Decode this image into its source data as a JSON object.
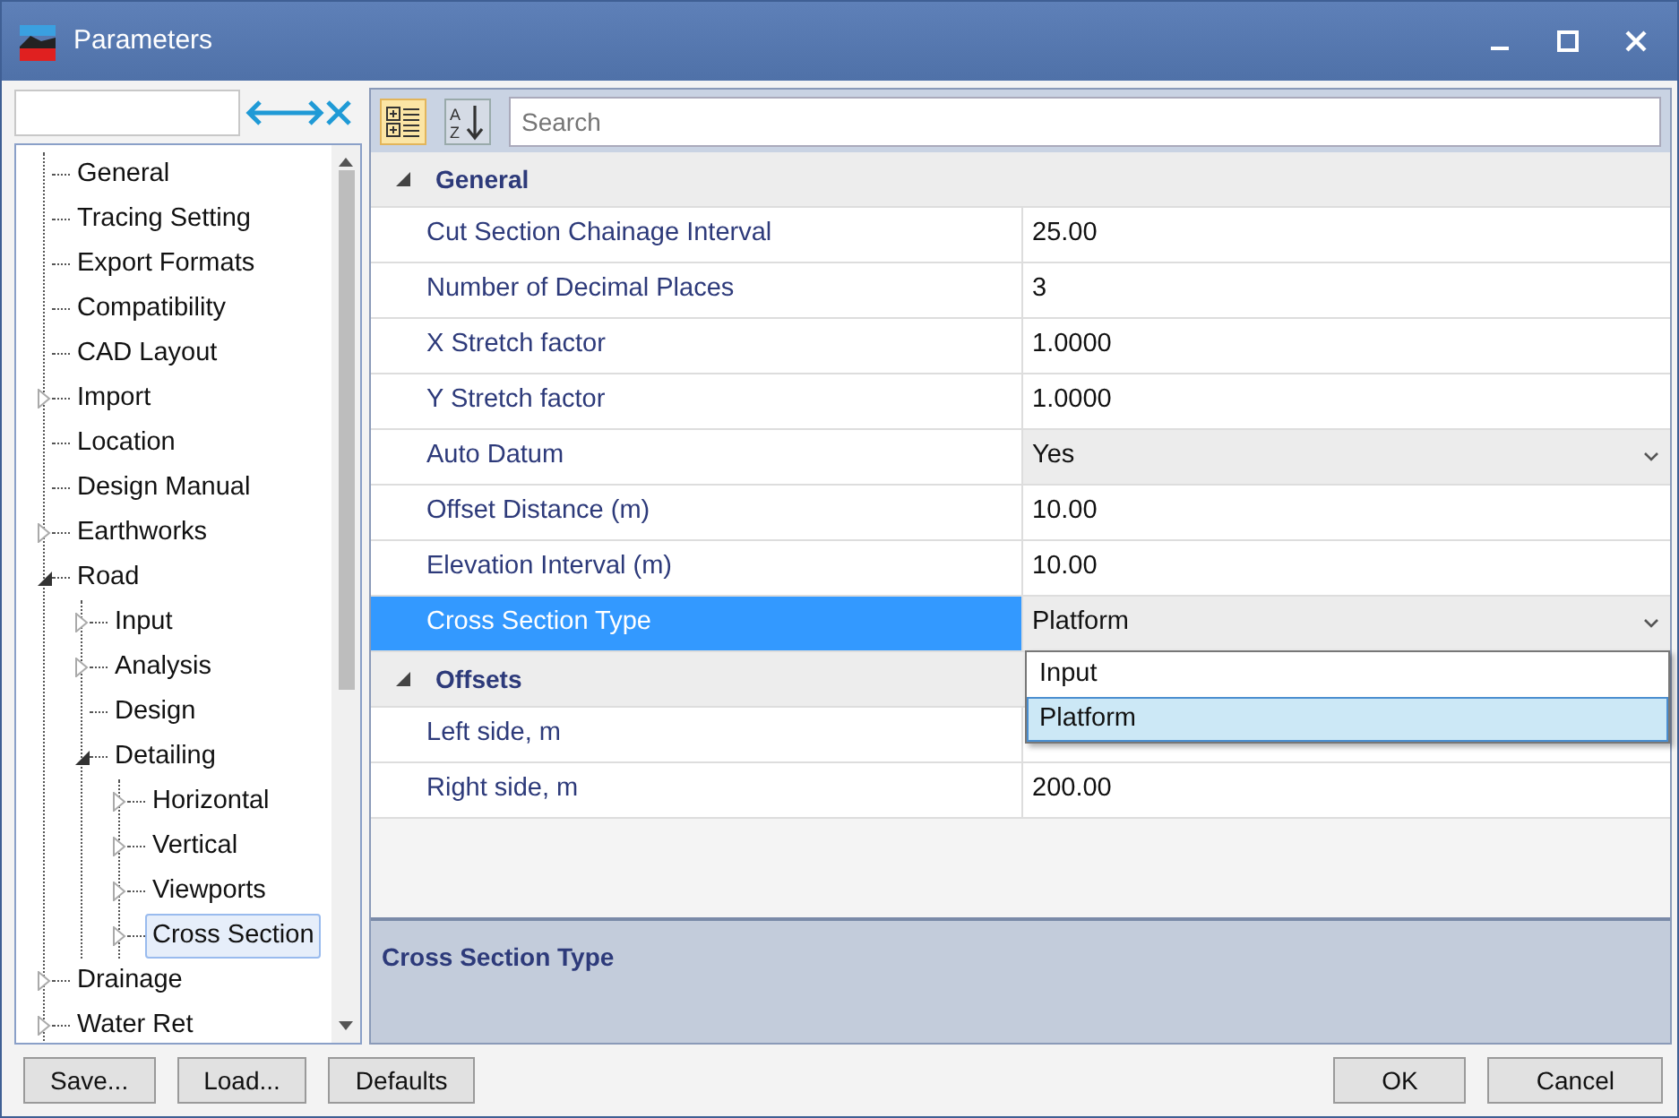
{
  "window": {
    "title": "Parameters"
  },
  "tree": {
    "nodes": [
      {
        "label": "General",
        "expandable": false,
        "selected": false
      },
      {
        "label": "Tracing Setting",
        "expandable": false,
        "selected": false
      },
      {
        "label": "Export Formats",
        "expandable": false,
        "selected": false
      },
      {
        "label": "Compatibility",
        "expandable": false,
        "selected": false
      },
      {
        "label": "CAD Layout",
        "expandable": false,
        "selected": false
      },
      {
        "label": "Import",
        "expandable": true,
        "expanded": false,
        "selected": false
      },
      {
        "label": "Location",
        "expandable": false,
        "selected": false
      },
      {
        "label": "Design Manual",
        "expandable": false,
        "selected": false
      },
      {
        "label": "Earthworks",
        "expandable": true,
        "expanded": false,
        "selected": false
      },
      {
        "label": "Road",
        "expandable": true,
        "expanded": true,
        "selected": false,
        "children": [
          {
            "label": "Input",
            "expandable": true,
            "expanded": false,
            "selected": false
          },
          {
            "label": "Analysis",
            "expandable": true,
            "expanded": false,
            "selected": false
          },
          {
            "label": "Design",
            "expandable": false,
            "selected": false
          },
          {
            "label": "Detailing",
            "expandable": true,
            "expanded": true,
            "selected": false,
            "children": [
              {
                "label": "Horizontal",
                "expandable": true,
                "expanded": false,
                "selected": false
              },
              {
                "label": "Vertical",
                "expandable": true,
                "expanded": false,
                "selected": false
              },
              {
                "label": "Viewports",
                "expandable": true,
                "expanded": false,
                "selected": false
              },
              {
                "label": "Cross Section",
                "expandable": true,
                "expanded": false,
                "selected": true
              }
            ]
          }
        ]
      },
      {
        "label": "Drainage",
        "expandable": true,
        "expanded": false,
        "selected": false
      },
      {
        "label": "Water Ret",
        "expandable": true,
        "expanded": false,
        "selected": false
      }
    ]
  },
  "toolbar": {
    "categorized": {
      "selected": true
    },
    "alphabetical": {
      "selected": false,
      "letters": [
        "A",
        "Z"
      ]
    },
    "search": {
      "placeholder": "Search"
    }
  },
  "groups": [
    {
      "title": "General",
      "expanded": true,
      "rows": [
        {
          "label": "Cut Section Chainage Interval",
          "kind": "text",
          "value": "25.00",
          "selected": false
        },
        {
          "label": "Number of Decimal Places",
          "kind": "text",
          "value": "3",
          "selected": false
        },
        {
          "label": "X Stretch factor",
          "kind": "text",
          "value": "1.0000",
          "selected": false
        },
        {
          "label": "Y Stretch factor",
          "kind": "text",
          "value": "1.0000",
          "selected": false
        },
        {
          "label": "Auto Datum",
          "kind": "dropdown",
          "value": "Yes",
          "selected": false
        },
        {
          "label": "Offset Distance (m)",
          "kind": "text",
          "value": "10.00",
          "selected": false
        },
        {
          "label": "Elevation Interval (m)",
          "kind": "text",
          "value": "10.00",
          "selected": false
        },
        {
          "label": "Cross Section Type",
          "kind": "dropdown",
          "value": "Platform",
          "selected": true,
          "options": [
            {
              "label": "Input",
              "selected": false
            },
            {
              "label": "Platform",
              "selected": true
            }
          ]
        }
      ]
    },
    {
      "title": "Offsets",
      "expanded": true,
      "rows": [
        {
          "label": "Left side, m",
          "kind": "text",
          "selected": false
        },
        {
          "label": "Right side, m",
          "kind": "text",
          "value": "200.00",
          "selected": false
        }
      ]
    }
  ],
  "description": {
    "title": "Cross Section Type"
  },
  "buttons_left": [
    "Save...",
    "Load...",
    "Defaults"
  ],
  "buttons_right": [
    "OK",
    "Cancel"
  ]
}
